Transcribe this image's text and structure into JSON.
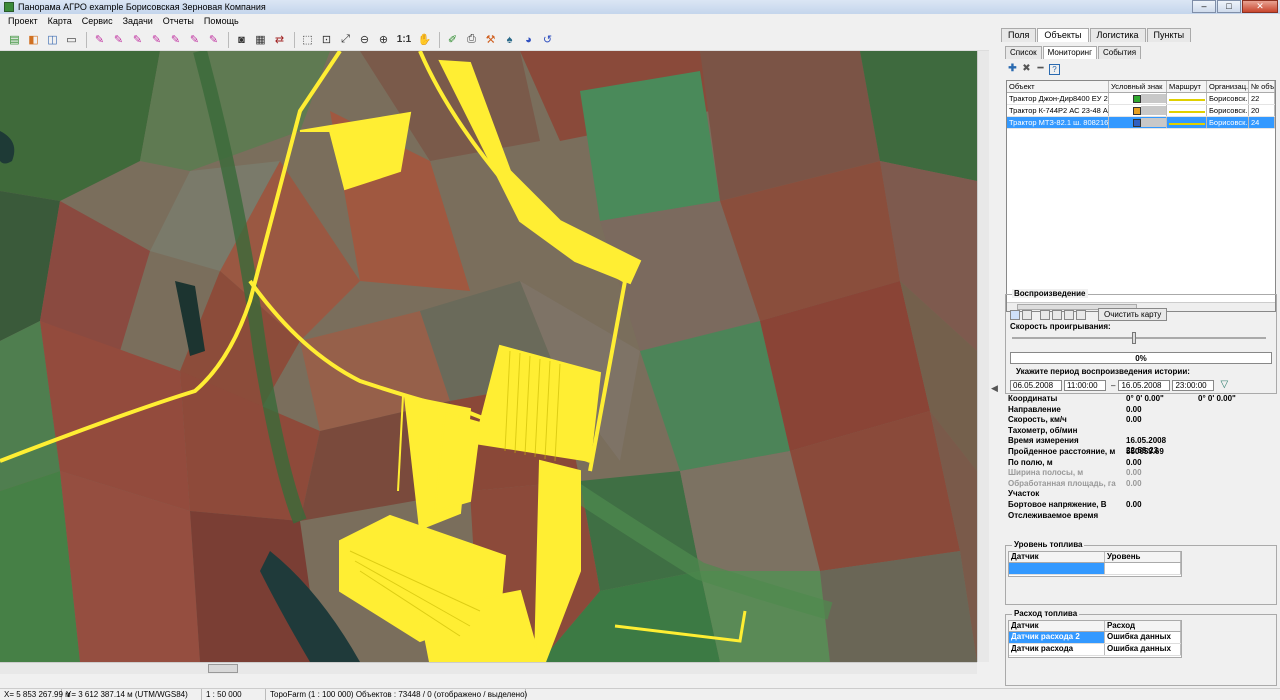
{
  "window": {
    "title": "Панорама АГРО  example   Борисовская Зерновая Компания",
    "min": "–",
    "max": "□",
    "close": "✕"
  },
  "menu": [
    "Проект",
    "Карта",
    "Сервис",
    "Задачи",
    "Отчеты",
    "Помощь"
  ],
  "toolbar": {
    "scale_label": "1:1"
  },
  "status": {
    "x": "X= 5 853 267.99 м",
    "y": "Y= 3 612 387.14 м  (UTM/WGS84)",
    "scale": "1 : 50 000",
    "layer": "TopoFarm (1 : 100 000)  Объектов : 73448 / 0 (отображено / выделено)"
  },
  "right": {
    "tabs": [
      "Поля",
      "Объекты",
      "Логистика",
      "Пункты"
    ],
    "active_tab": "Объекты",
    "subtabs": [
      "Список",
      "Мониторинг",
      "События"
    ],
    "active_subtab": "Мониторинг",
    "objects": {
      "headers": [
        "Объект",
        "Условный знак",
        "Маршрут",
        "Организац.",
        "№ объ"
      ],
      "rows": [
        {
          "name": "Трактор Джон-Дир8400 ЕУ 2",
          "org": "Борисовск.",
          "num": "22",
          "symbol_color": "#2fa82f",
          "route_color": "#e8d000"
        },
        {
          "name": "Трактор К-744Р2 АС 23-48 АС",
          "org": "Борисовск.",
          "num": "20",
          "symbol_color": "#e8a020",
          "route_color": "#e8d000"
        },
        {
          "name": "Трактор МТЗ-82.1 ш. 808216",
          "org": "Борисовск.",
          "num": "24",
          "symbol_color": "#3060c0",
          "route_color": "#e8d000"
        }
      ]
    },
    "playback": {
      "title": "Воспроизведение",
      "clear_label": "Очистить карту",
      "speed_label": "Скорость проигрывания:",
      "progress": "0%",
      "period_label": "Укажите период воспроизведения истории:",
      "from_date": "06.05.2008",
      "from_time": "11:00:00",
      "to_date": "16.05.2008",
      "to_time": "23:00:00",
      "dash": "–"
    },
    "info": [
      {
        "k": "Координаты",
        "v": "0°  0'  0.00\"",
        "v2": "0°  0'  0.00\"",
        "dim": false
      },
      {
        "k": "Направление",
        "v": "0.00",
        "v2": "",
        "dim": false
      },
      {
        "k": "Скорость, км/ч",
        "v": "0.00",
        "v2": "",
        "dim": false
      },
      {
        "k": "Тахометр, об/мин",
        "v": "",
        "v2": "",
        "dim": false
      },
      {
        "k": "Время измерения",
        "v": "16.05.2008 22:58:23",
        "v2": "",
        "dim": false
      },
      {
        "k": "Пройденное расстояние, м",
        "v": "550059.69",
        "v2": "",
        "dim": false
      },
      {
        "k": "По полю, м",
        "v": "0.00",
        "v2": "",
        "dim": false
      },
      {
        "k": "Ширина полосы, м",
        "v": "0.00",
        "v2": "",
        "dim": true
      },
      {
        "k": "Обработанная площадь, га",
        "v": "0.00",
        "v2": "",
        "dim": true
      },
      {
        "k": "Участок",
        "v": "",
        "v2": "",
        "dim": false
      },
      {
        "k": "Бортовое напряжение, В",
        "v": "0.00",
        "v2": "",
        "dim": false
      },
      {
        "k": "Отслеживаемое время",
        "v": "",
        "v2": "",
        "dim": false
      }
    ],
    "fuel_level": {
      "title": "Уровень топлива",
      "headers": [
        "Датчик",
        "Уровень"
      ],
      "rows": [
        {
          "a": "",
          "b": ""
        }
      ]
    },
    "fuel_flow": {
      "title": "Расход топлива",
      "headers": [
        "Датчик",
        "Расход"
      ],
      "rows": [
        {
          "a": "Датчик расхода 2",
          "b": "Ошибка данных"
        },
        {
          "a": "Датчик расхода",
          "b": "Ошибка данных"
        }
      ]
    }
  },
  "colors": {
    "track": "#ffee33",
    "selection": "#3399ff"
  }
}
